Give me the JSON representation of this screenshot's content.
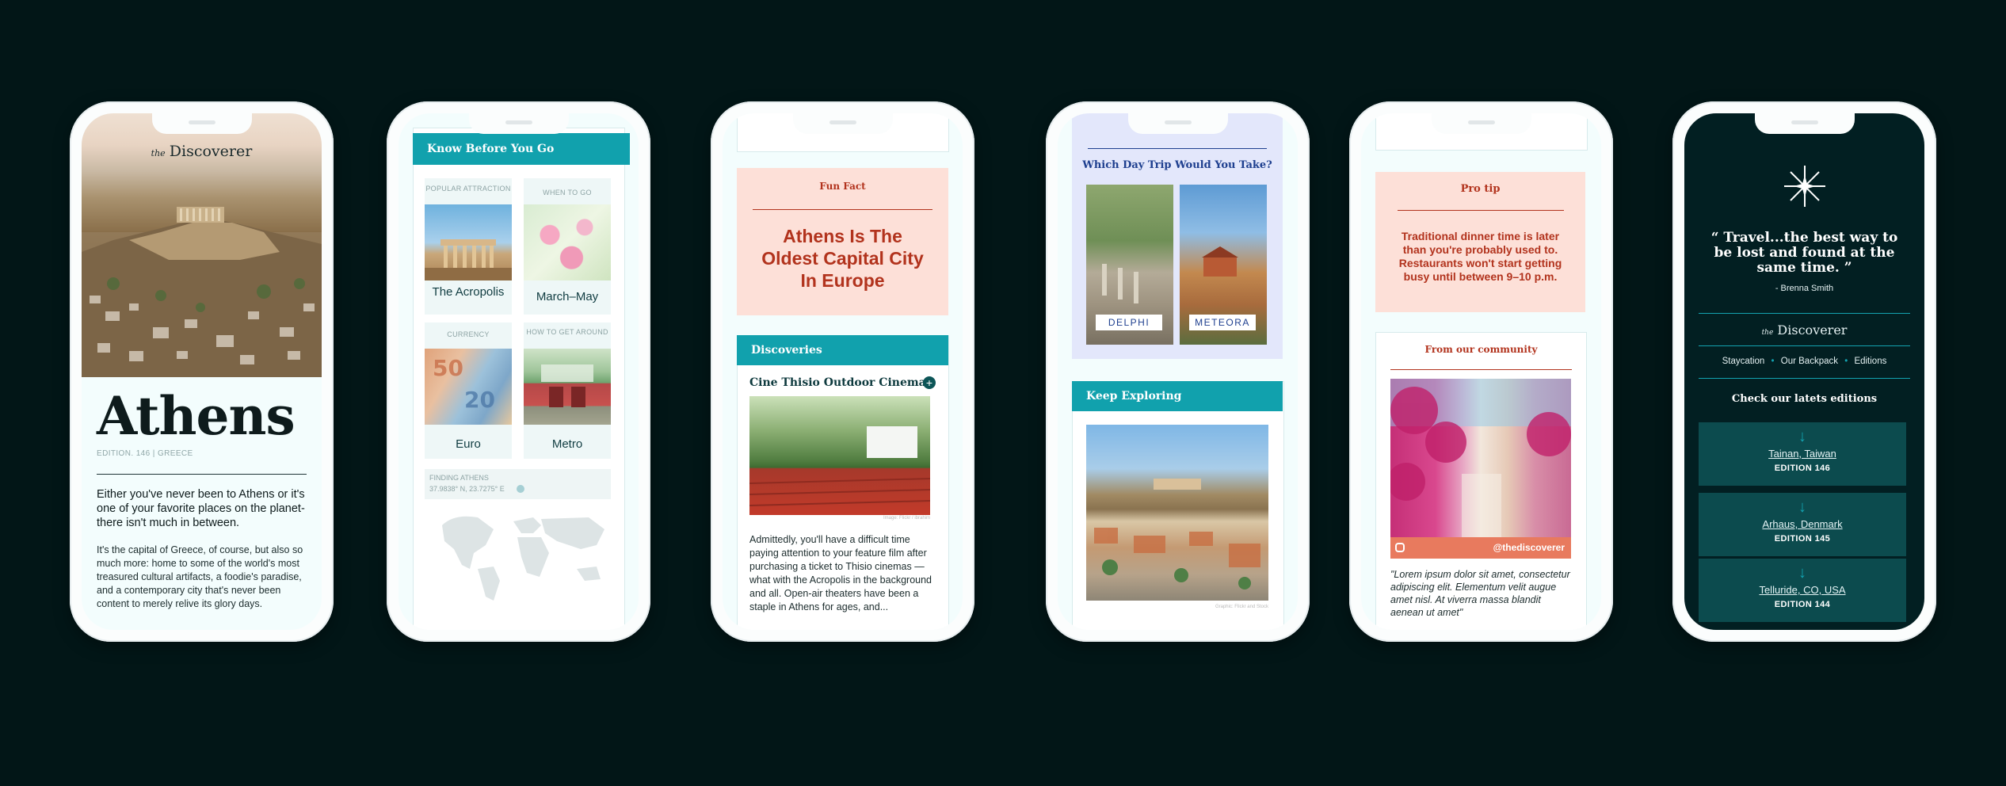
{
  "phone1": {
    "brand_prefix": "the",
    "brand_name": "Discoverer",
    "title": "Athens",
    "edition": "EDITION. 146 | GREECE",
    "lead": "Either you've never been to Athens or it's one of your favorite places on the planet- there isn't much in between.",
    "body": "It's the capital of Greece, of course, but also so much more: home to some of the world's most treasured cultural artifacts, a foodie's paradise, and a contemporary city that's never been content to merely relive its glory days."
  },
  "phone2": {
    "header": "Know Before You Go",
    "cells": [
      {
        "label": "POPULAR ATTRACTION",
        "value": "The Acropolis"
      },
      {
        "label": "WHEN TO GO",
        "value": "March–May"
      },
      {
        "label": "CURRENCY",
        "value": "Euro"
      },
      {
        "label": "HOW TO GET AROUND",
        "value": "Metro"
      }
    ],
    "finding_label": "FINDING ATHENS",
    "coordinates": "37.9838° N, 23.7275° E"
  },
  "phone3": {
    "fun_fact_label": "Fun Fact",
    "fun_fact": "Athens Is The Oldest Capital City In Europe",
    "discoveries_header": "Discoveries",
    "item_title": "Cine Thisio Outdoor Cinema",
    "photo_credit": "Image: Flickr / ibrahim",
    "item_body": "Admittedly, you'll have a difficult time paying attention to your feature film after purchasing a ticket to Thisio cinemas — what with the Acropolis in the background and all. Open-air theaters have been a staple in Athens for ages, and..."
  },
  "phone4": {
    "question": "Which Day Trip Would You Take?",
    "option_a": "DELPHI",
    "option_b": "METEORA",
    "keep_header": "Keep Exploring",
    "photo_credit": "Graphic: Flickr and Stock"
  },
  "phone5": {
    "tip_label": "Pro tip",
    "tip": "Traditional dinner time is later than you're probably used to. Restaurants won't start getting busy until between 9–10 p.m.",
    "community_label": "From our community",
    "handle": "@thediscoverer",
    "caption": "\"Lorem ipsum dolor sit amet, consectetur adipiscing elit. Elementum velit augue amet nisl. At viverra massa blandit aenean ut amet\""
  },
  "phone6": {
    "quote": "“ Travel...the best way to be lost and found at the same time. ”",
    "author": "- Brenna Smith",
    "brand_prefix": "the",
    "brand_name": "Discoverer",
    "nav": [
      "Staycation",
      "Our Backpack",
      "Editions"
    ],
    "check_label": "Check our latets editions",
    "editions": [
      {
        "place": "Tainan, Taiwan",
        "edition": "EDITION 146"
      },
      {
        "place": "Arhaus, Denmark",
        "edition": "EDITION 145"
      },
      {
        "place": "Telluride, CO, USA",
        "edition": "EDITION 144"
      }
    ]
  },
  "colors": {
    "background": "#021617",
    "teal": "#11a1ad",
    "salmon": "#fde0d8",
    "rust": "#b2331d",
    "navy": "#1e3f8f",
    "lavender": "#e3e7fb",
    "dark_teal": "#021f22"
  }
}
